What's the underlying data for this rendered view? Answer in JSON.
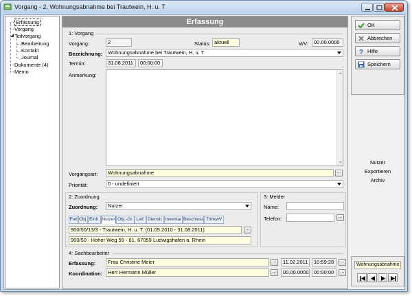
{
  "window": {
    "title": "Vorgang - 2, Wohnungsabnahme bei Trautwein, H. u. T"
  },
  "tree": {
    "items": [
      {
        "label": "Erfassung"
      },
      {
        "label": "Vorgang"
      },
      {
        "label": "Teilvorgang"
      },
      {
        "label": "Bearbeitung"
      },
      {
        "label": "Kontakt"
      },
      {
        "label": "Journal"
      },
      {
        "label": "Dokumente (4)"
      },
      {
        "label": "Memo"
      }
    ]
  },
  "main": {
    "header": "Erfassung",
    "section1": {
      "title": "1: Vorgang",
      "vorgang_label": "Vorgang:",
      "vorgang_value": "2",
      "status_label": "Status:",
      "status_value": "aktuell",
      "wv_label": "WV:",
      "wv_value": "00.00.0000",
      "bezeichnung_label": "Bezeichnung:",
      "bezeichnung_value": "Wohnungsabnahme bei Trautwein, H. u. T",
      "termin_label": "Termin:",
      "termin_date": "31.08.2011",
      "termin_time": "00:00:00",
      "anmerkung_label": "Anmerkung:",
      "vorgangsart_label": "Vorgangsart:",
      "vorgangsart_value": "Wohnungsabnahme",
      "prioritaet_label": "Priorität:",
      "prioritaet_value": "0 - undefiniert"
    },
    "section2": {
      "title": "2: Zuordnung",
      "zuordnung_label": "Zuordnung:",
      "zuordnung_value": "Nutzer",
      "tabs": [
        "Frei",
        "Obj.",
        "Einh.",
        "Nutzer",
        "Obj.-Gr.",
        "Lief.",
        "Dienstl.",
        "Inventar",
        "Beschluss",
        "TrinkwV"
      ],
      "line1": "900/50/13/3 - Trautwein, H. u. T.  (01.05.2010 - 31.08.2011)",
      "line2": "900/50 - Hoher Weg 59 - 61, 67059 Ludwigshafen a. Rhein"
    },
    "section3": {
      "title": "3: Melder",
      "name_label": "Name:",
      "name_value": "",
      "telefon_label": "Telefon:",
      "telefon_value": ""
    },
    "section4": {
      "title": "4: Sachbearbeiter",
      "erfassung_label": "Erfassung:",
      "erfassung_value": "Frau Christine Meier",
      "erfassung_date": "11.02.2011",
      "erfassung_time": "10:59:28",
      "koordination_label": "Koordination:",
      "koordination_value": "Herr Hermann Müller",
      "koordination_date": "00.00.0000",
      "koordination_time": "00:00:00"
    }
  },
  "buttons": {
    "ok": "OK",
    "cancel": "Abbrechen",
    "help": "Hilfe",
    "save": "Speichern"
  },
  "links": {
    "nutzer": "Nutzer",
    "exportieren": "Exportieren",
    "archiv": "Archiv"
  },
  "navigator": {
    "label": "Wohnungsabnahme"
  }
}
